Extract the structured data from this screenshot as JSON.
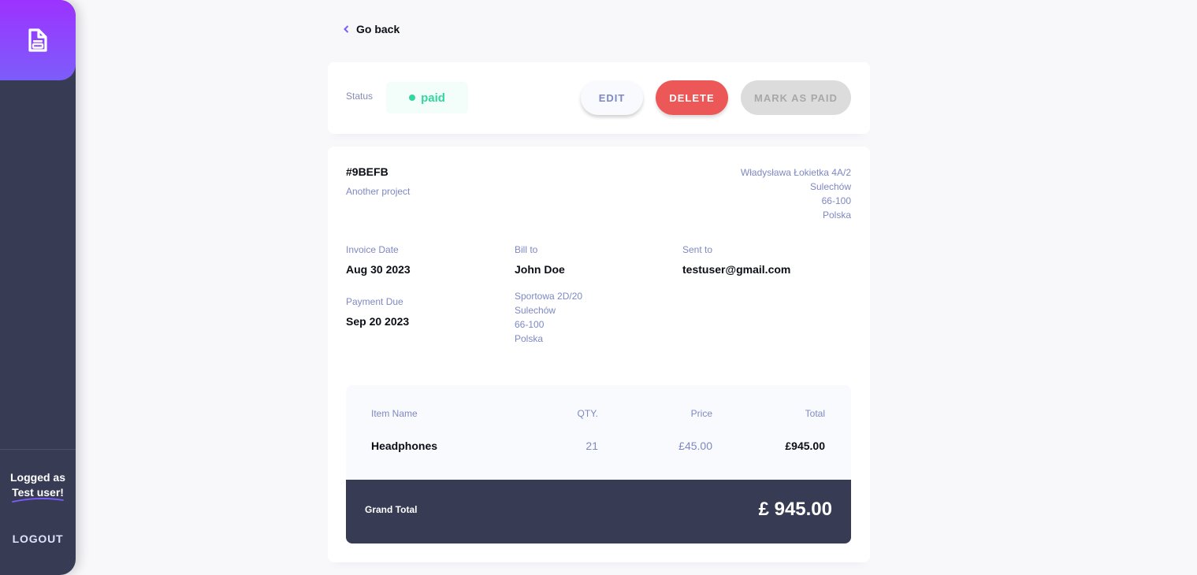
{
  "nav": {
    "back_label": "Go back"
  },
  "status": {
    "label": "Status",
    "value": "paid",
    "color": "#33d69f"
  },
  "actions": {
    "edit": "EDIT",
    "delete": "DELETE",
    "mark_paid": "MARK AS PAID"
  },
  "invoice": {
    "id": "#9BEFB",
    "description": "Another project",
    "sender_address": [
      "Władysława Łokietka 4A/2",
      "Sulechów",
      "66-100",
      "Polska"
    ],
    "invoice_date_label": "Invoice Date",
    "invoice_date": "Aug 30 2023",
    "payment_due_label": "Payment Due",
    "payment_due": "Sep 20 2023",
    "bill_to_label": "Bill to",
    "client_name": "John Doe",
    "client_address": [
      "Sportowa 2D/20",
      "Sulechów",
      "66-100",
      "Polska"
    ],
    "sent_to_label": "Sent to",
    "client_email": "testuser@gmail.com"
  },
  "items": {
    "headers": [
      "Item Name",
      "QTY.",
      "Price",
      "Total"
    ],
    "rows": [
      {
        "name": "Headphones",
        "qty": "21",
        "price": "£45.00",
        "total": "£945.00"
      }
    ]
  },
  "grand_total": {
    "label": "Grand Total",
    "amount": "£ 945.00"
  },
  "sidebar": {
    "logged_as": "Logged as",
    "user": "Test user!",
    "logout": "LOGOUT"
  },
  "colors": {
    "accent": "#7c5dfa",
    "danger": "#ec5757",
    "dark": "#373b53"
  }
}
